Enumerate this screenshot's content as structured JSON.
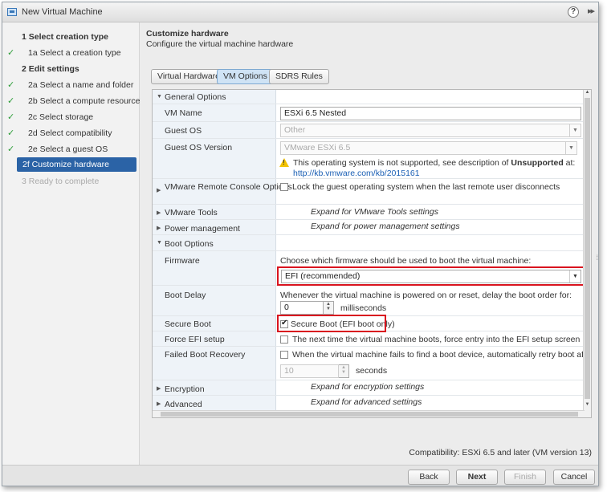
{
  "window": {
    "title": "New Virtual Machine",
    "help": "?"
  },
  "nav": {
    "items": [
      {
        "label": "1  Select creation type",
        "state": "section"
      },
      {
        "label": "1a  Select a creation type",
        "state": "done"
      },
      {
        "label": "2  Edit settings",
        "state": "section"
      },
      {
        "label": "2a  Select a name and folder",
        "state": "done"
      },
      {
        "label": "2b  Select a compute resource",
        "state": "done"
      },
      {
        "label": "2c  Select storage",
        "state": "done"
      },
      {
        "label": "2d  Select compatibility",
        "state": "done"
      },
      {
        "label": "2e  Select a guest OS",
        "state": "done"
      },
      {
        "label": "2f  Customize hardware",
        "state": "active"
      },
      {
        "label": "3  Ready to complete",
        "state": "disabled"
      }
    ]
  },
  "header": {
    "title": "Customize hardware",
    "subtitle": "Configure the virtual machine hardware"
  },
  "tabs": [
    {
      "label": "Virtual Hardware"
    },
    {
      "label": "VM Options"
    },
    {
      "label": "SDRS Rules"
    }
  ],
  "options": {
    "general": {
      "label": "General Options",
      "vm_name_label": "VM Name",
      "vm_name_value": "ESXi 6.5 Nested",
      "guest_os_label": "Guest OS",
      "guest_os_value": "Other",
      "guest_os_version_label": "Guest OS Version",
      "guest_os_version_value": "VMware ESXi 6.5",
      "warning_text": "This operating system is not supported, see description of",
      "warning_bold": "Unsupported",
      "warning_suffix": "at:",
      "warning_link": "http://kb.vmware.com/kb/2015161"
    },
    "remote_console": {
      "label": "VMware Remote Console Options",
      "checkbox_label": "Lock the guest operating system when the last remote user disconnects"
    },
    "tools": {
      "label": "VMware Tools",
      "hint": "Expand for VMware Tools settings"
    },
    "power": {
      "label": "Power management",
      "hint": "Expand for power management settings"
    },
    "boot": {
      "label": "Boot Options",
      "firmware_label": "Firmware",
      "firmware_desc": "Choose which firmware should be used to boot the virtual machine:",
      "firmware_value": "EFI (recommended)",
      "boot_delay_label": "Boot Delay",
      "boot_delay_desc": "Whenever the virtual machine is powered on or reset, delay the boot order for:",
      "boot_delay_value": "0",
      "boot_delay_unit": "milliseconds",
      "secure_boot_label": "Secure Boot",
      "secure_boot_checkbox": "Secure Boot (EFI boot only)",
      "force_efi_label": "Force EFI setup",
      "force_efi_checkbox": "The next time the virtual machine boots, force entry into the EFI setup screen",
      "failed_boot_label": "Failed Boot Recovery",
      "failed_boot_checkbox": "When the virtual machine fails to find a boot device, automatically retry boot after:",
      "retry_value": "10",
      "retry_unit": "seconds"
    },
    "encryption": {
      "label": "Encryption",
      "hint": "Expand for encryption settings"
    },
    "advanced": {
      "label": "Advanced",
      "hint": "Expand for advanced settings"
    }
  },
  "compatibility": "Compatibility: ESXi 6.5 and later (VM version 13)",
  "footer": {
    "back": "Back",
    "next": "Next",
    "finish": "Finish",
    "cancel": "Cancel"
  },
  "colors": {
    "accent": "#2b63a6",
    "highlight": "#d9141f",
    "check": "#2e9e3a",
    "warning": "#f2c200",
    "link": "#1a5fb4"
  }
}
